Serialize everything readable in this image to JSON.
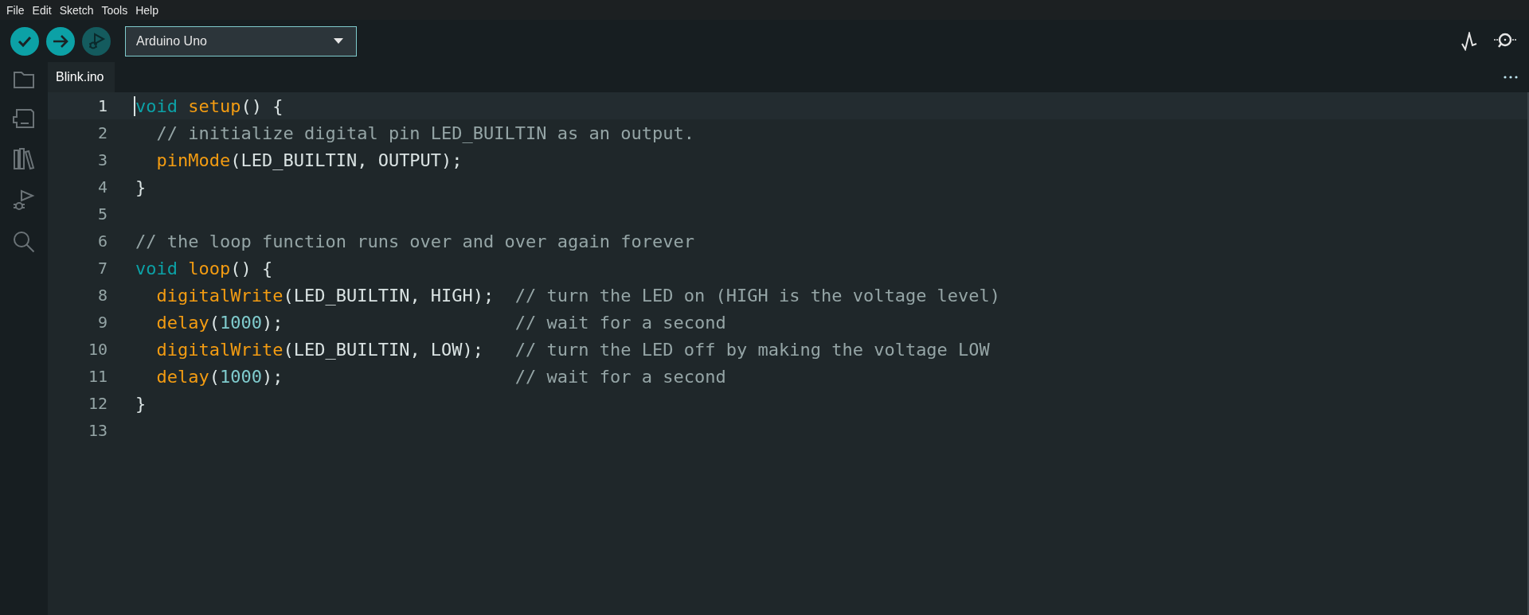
{
  "menu": [
    "File",
    "Edit",
    "Sketch",
    "Tools",
    "Help"
  ],
  "toolbar": {
    "buttons": [
      {
        "kind": "verify",
        "disabled": false
      },
      {
        "kind": "upload",
        "disabled": false
      },
      {
        "kind": "debug",
        "disabled": true
      }
    ],
    "board": "Arduino Uno"
  },
  "tabs": [
    {
      "label": "Blink.ino",
      "selected": true
    }
  ],
  "editor": {
    "lines": [
      {
        "number": "1",
        "current": true,
        "indent": false,
        "tokens": [
          {
            "kind": "keyword",
            "text": "void"
          },
          {
            "kind": "function",
            "text": "setup"
          },
          {
            "kind": "plain",
            "text": "() {"
          }
        ]
      },
      {
        "number": "2",
        "current": false,
        "indent": true,
        "tokens": [
          {
            "kind": "comment",
            "text": "// initialize digital pin LED_BUILTIN as an output."
          }
        ]
      },
      {
        "number": "3",
        "current": false,
        "indent": true,
        "tokens": [
          {
            "kind": "function",
            "text": "pinMode"
          },
          {
            "kind": "plain",
            "text": "(LED_BUILTIN, OUTPUT);"
          }
        ]
      },
      {
        "number": "4",
        "current": false,
        "indent": false,
        "tokens": [
          {
            "kind": "plain",
            "text": "}"
          }
        ]
      },
      {
        "number": "5",
        "current": false
      },
      {
        "number": "6",
        "current": false,
        "indent": false,
        "tokens": [
          {
            "kind": "comment",
            "text": "// the loop function runs over and over again forever"
          }
        ]
      },
      {
        "number": "7",
        "current": false,
        "indent": false,
        "tokens": [
          {
            "kind": "keyword",
            "text": "void"
          },
          {
            "kind": "function",
            "text": "loop"
          },
          {
            "kind": "plain",
            "text": "() {"
          }
        ]
      },
      {
        "number": "8",
        "current": false,
        "indent": true,
        "tokens": [
          {
            "kind": "function",
            "text": "digitalWrite"
          },
          {
            "kind": "plain",
            "text": "(LED_BUILTIN, HIGH);"
          },
          {
            "kind": "trailing_comment",
            "text": "// turn the LED on (HIGH is the voltage level)"
          }
        ]
      },
      {
        "number": "9",
        "current": false,
        "indent": true,
        "tokens": [
          {
            "kind": "function",
            "text": "delay"
          },
          {
            "kind": "plain",
            "text": "("
          },
          {
            "kind": "number",
            "text": "1000"
          },
          {
            "kind": "plain",
            "text": ");"
          },
          {
            "kind": "trailing_comment",
            "text": "// wait for a second"
          }
        ]
      },
      {
        "number": "10",
        "current": false,
        "indent": true,
        "tokens": [
          {
            "kind": "function",
            "text": "digitalWrite"
          },
          {
            "kind": "plain",
            "text": "(LED_BUILTIN, LOW);"
          },
          {
            "kind": "trailing_comment",
            "text": "// turn the LED off by making the voltage LOW"
          }
        ]
      },
      {
        "number": "11",
        "current": false,
        "indent": true,
        "tokens": [
          {
            "kind": "function",
            "text": "delay"
          },
          {
            "kind": "plain",
            "text": "("
          },
          {
            "kind": "number",
            "text": "1000"
          },
          {
            "kind": "plain",
            "text": ");"
          },
          {
            "kind": "trailing_comment",
            "text": "// wait for a second"
          }
        ]
      },
      {
        "number": "12",
        "current": false,
        "indent": false,
        "tokens": [
          {
            "kind": "plain",
            "text": "}"
          }
        ]
      },
      {
        "number": "13",
        "current": false
      }
    ]
  }
}
